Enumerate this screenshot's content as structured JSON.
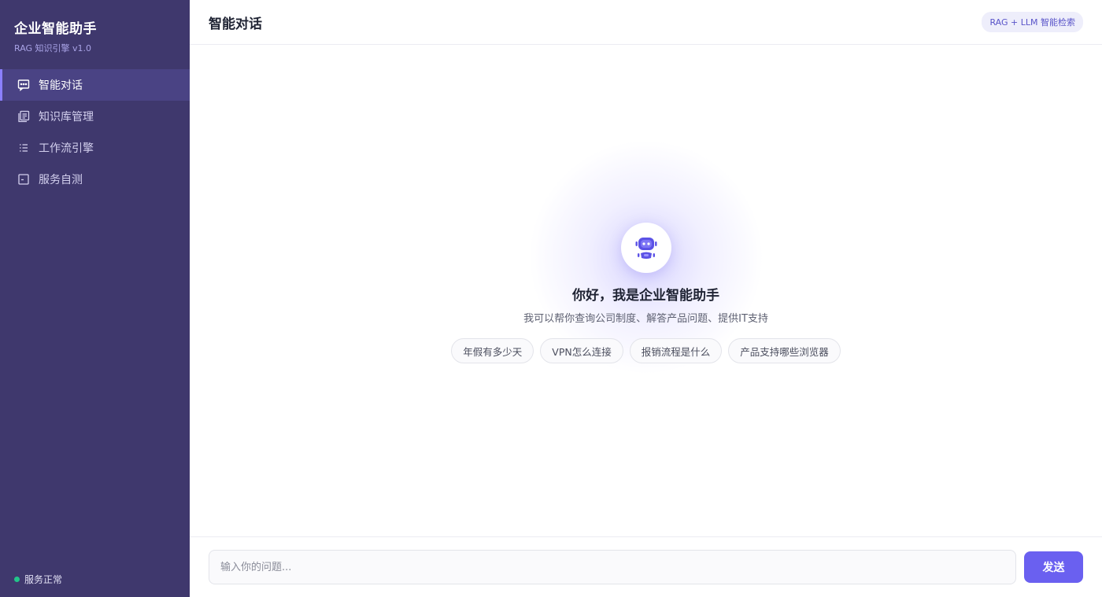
{
  "sidebar": {
    "brand_title": "企业智能助手",
    "brand_sub": "RAG 知识引擎 v1.0",
    "items": [
      {
        "label": "智能对话",
        "icon": "chat-icon",
        "active": true
      },
      {
        "label": "知识库管理",
        "icon": "library-icon",
        "active": false
      },
      {
        "label": "工作流引擎",
        "icon": "list-icon",
        "active": false
      },
      {
        "label": "服务自测",
        "icon": "terminal-icon",
        "active": false
      }
    ],
    "status": "服务正常"
  },
  "header": {
    "title": "智能对话",
    "badge": "RAG + LLM 智能检索"
  },
  "welcome": {
    "title": "你好，我是企业智能助手",
    "subtitle": "我可以帮你查询公司制度、解答产品问题、提供IT支持",
    "suggestions": [
      "年假有多少天",
      "VPN怎么连接",
      "报销流程是什么",
      "产品支持哪些浏览器"
    ]
  },
  "input": {
    "placeholder": "输入你的问题...",
    "value": "",
    "send_label": "发送"
  },
  "colors": {
    "sidebar_bg": "#3f386d",
    "accent": "#6a60f0",
    "status_ok": "#22c58a"
  }
}
